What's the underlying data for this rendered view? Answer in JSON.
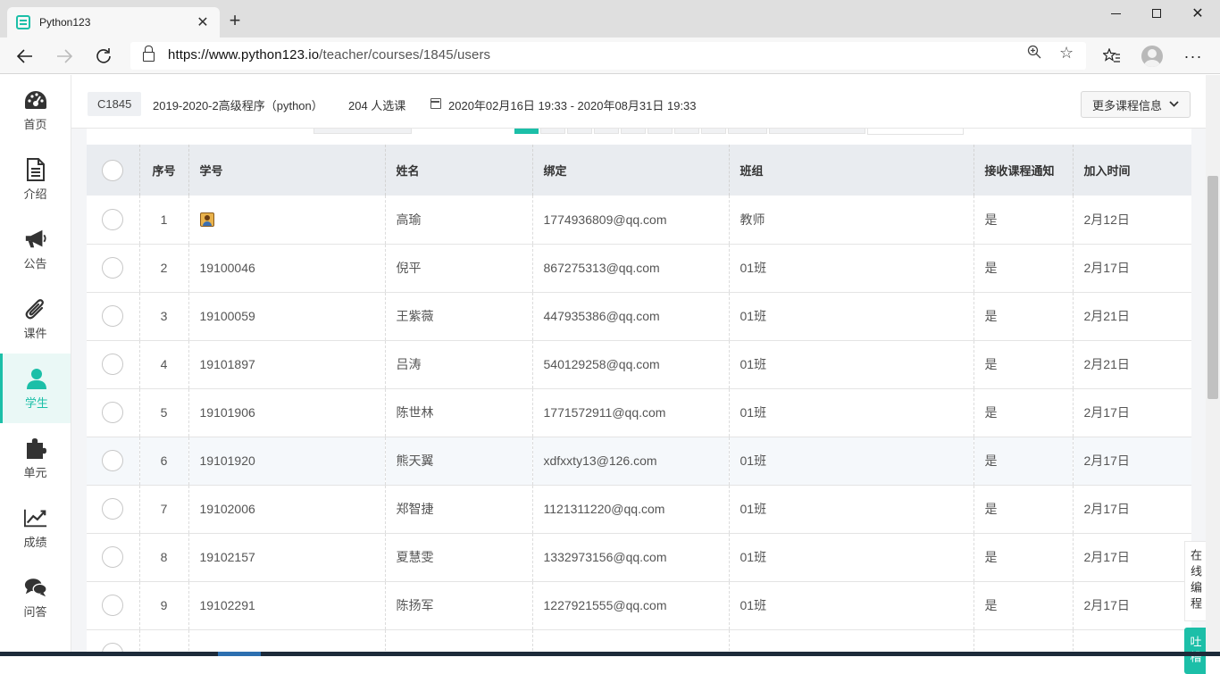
{
  "browser": {
    "tab_title": "Python123",
    "url_host": "https://www.python123.io",
    "url_path": "/teacher/courses/1845/users",
    "new_tab_label": "+",
    "tab_close_label": "✕"
  },
  "sidebar": {
    "items": [
      {
        "label": "首页",
        "icon": "dashboard-icon"
      },
      {
        "label": "介绍",
        "icon": "document-icon"
      },
      {
        "label": "公告",
        "icon": "megaphone-icon"
      },
      {
        "label": "课件",
        "icon": "paperclip-icon"
      },
      {
        "label": "学生",
        "icon": "user-icon",
        "active": true
      },
      {
        "label": "单元",
        "icon": "puzzle-icon"
      },
      {
        "label": "成绩",
        "icon": "line-chart-icon"
      },
      {
        "label": "问答",
        "icon": "chat-icon"
      }
    ]
  },
  "course": {
    "code": "C1845",
    "name": "2019-2020-2高级程序（python）",
    "count": "204 人选课",
    "date_range": "2020年02月16日 19:33 - 2020年08月31日 19:33",
    "more_label": "更多课程信息"
  },
  "table": {
    "headers": {
      "index": "序号",
      "student_id": "学号",
      "name": "姓名",
      "binding": "绑定",
      "group": "班组",
      "notify": "接收课程通知",
      "joined": "加入时间"
    },
    "rows": [
      {
        "index": "1",
        "student_id": "",
        "name": "高瑜",
        "binding": "1774936809@qq.com",
        "group": "教师",
        "notify": "是",
        "joined": "2月12日"
      },
      {
        "index": "2",
        "student_id": "19100046",
        "name": "倪平",
        "binding": "867275313@qq.com",
        "group": "01班",
        "notify": "是",
        "joined": "2月17日"
      },
      {
        "index": "3",
        "student_id": "19100059",
        "name": "王紫薇",
        "binding": "447935386@qq.com",
        "group": "01班",
        "notify": "是",
        "joined": "2月21日"
      },
      {
        "index": "4",
        "student_id": "19101897",
        "name": "吕涛",
        "binding": "540129258@qq.com",
        "group": "01班",
        "notify": "是",
        "joined": "2月21日"
      },
      {
        "index": "5",
        "student_id": "19101906",
        "name": "陈世林",
        "binding": "1771572911@qq.com",
        "group": "01班",
        "notify": "是",
        "joined": "2月17日"
      },
      {
        "index": "6",
        "student_id": "19101920",
        "name": "熊天翼",
        "binding": "xdfxxty13@126.com",
        "group": "01班",
        "notify": "是",
        "joined": "2月17日"
      },
      {
        "index": "7",
        "student_id": "19102006",
        "name": "郑智捷",
        "binding": "1121311220@qq.com",
        "group": "01班",
        "notify": "是",
        "joined": "2月17日"
      },
      {
        "index": "8",
        "student_id": "19102157",
        "name": "夏慧雯",
        "binding": "1332973156@qq.com",
        "group": "01班",
        "notify": "是",
        "joined": "2月17日"
      },
      {
        "index": "9",
        "student_id": "19102291",
        "name": "陈扬军",
        "binding": "1227921555@qq.com",
        "group": "01班",
        "notify": "是",
        "joined": "2月17日"
      }
    ]
  },
  "floating": {
    "online_coding": "在线编程",
    "feedback": "吐槽"
  },
  "colors": {
    "accent": "#1cbfa8"
  }
}
